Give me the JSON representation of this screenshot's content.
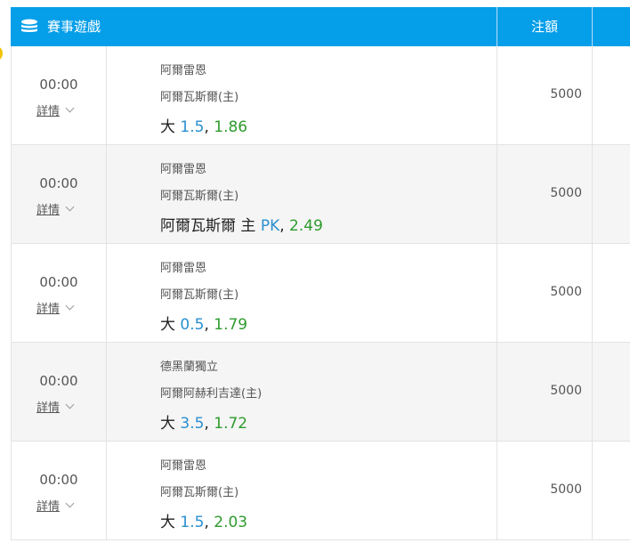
{
  "header": {
    "title": "賽事遊戲",
    "stake_label": "注額",
    "icon": "database-icon"
  },
  "colors": {
    "header_bg": "#049ee9",
    "line_blue": "#2a8fd0",
    "odds_green": "#2e9b2e",
    "alt_row": "#f5f5f5"
  },
  "rows": [
    {
      "time": "00:00",
      "detail": "詳情",
      "team1": "阿爾雷恩",
      "team2": "阿爾瓦斯爾(主)",
      "bet_prefix": "大 ",
      "bet_line": "1.5",
      "bet_sep": ", ",
      "bet_odds": "1.86",
      "stake": "5000"
    },
    {
      "time": "00:00",
      "detail": "詳情",
      "team1": "阿爾雷恩",
      "team2": "阿爾瓦斯爾(主)",
      "bet_prefix": "阿爾瓦斯爾 主 ",
      "bet_line": "PK",
      "bet_sep": ", ",
      "bet_odds": "2.49",
      "stake": "5000"
    },
    {
      "time": "00:00",
      "detail": "詳情",
      "team1": "阿爾雷恩",
      "team2": "阿爾瓦斯爾(主)",
      "bet_prefix": "大 ",
      "bet_line": "0.5",
      "bet_sep": ", ",
      "bet_odds": "1.79",
      "stake": "5000"
    },
    {
      "time": "00:00",
      "detail": "詳情",
      "team1": "德黑蘭獨立",
      "team2": "阿爾阿赫利吉達(主)",
      "bet_prefix": "大 ",
      "bet_line": "3.5",
      "bet_sep": ", ",
      "bet_odds": "1.72",
      "stake": "5000"
    },
    {
      "time": "00:00",
      "detail": "詳情",
      "team1": "阿爾雷恩",
      "team2": "阿爾瓦斯爾(主)",
      "bet_prefix": "大 ",
      "bet_line": "1.5",
      "bet_sep": ", ",
      "bet_odds": "2.03",
      "stake": "5000"
    }
  ]
}
